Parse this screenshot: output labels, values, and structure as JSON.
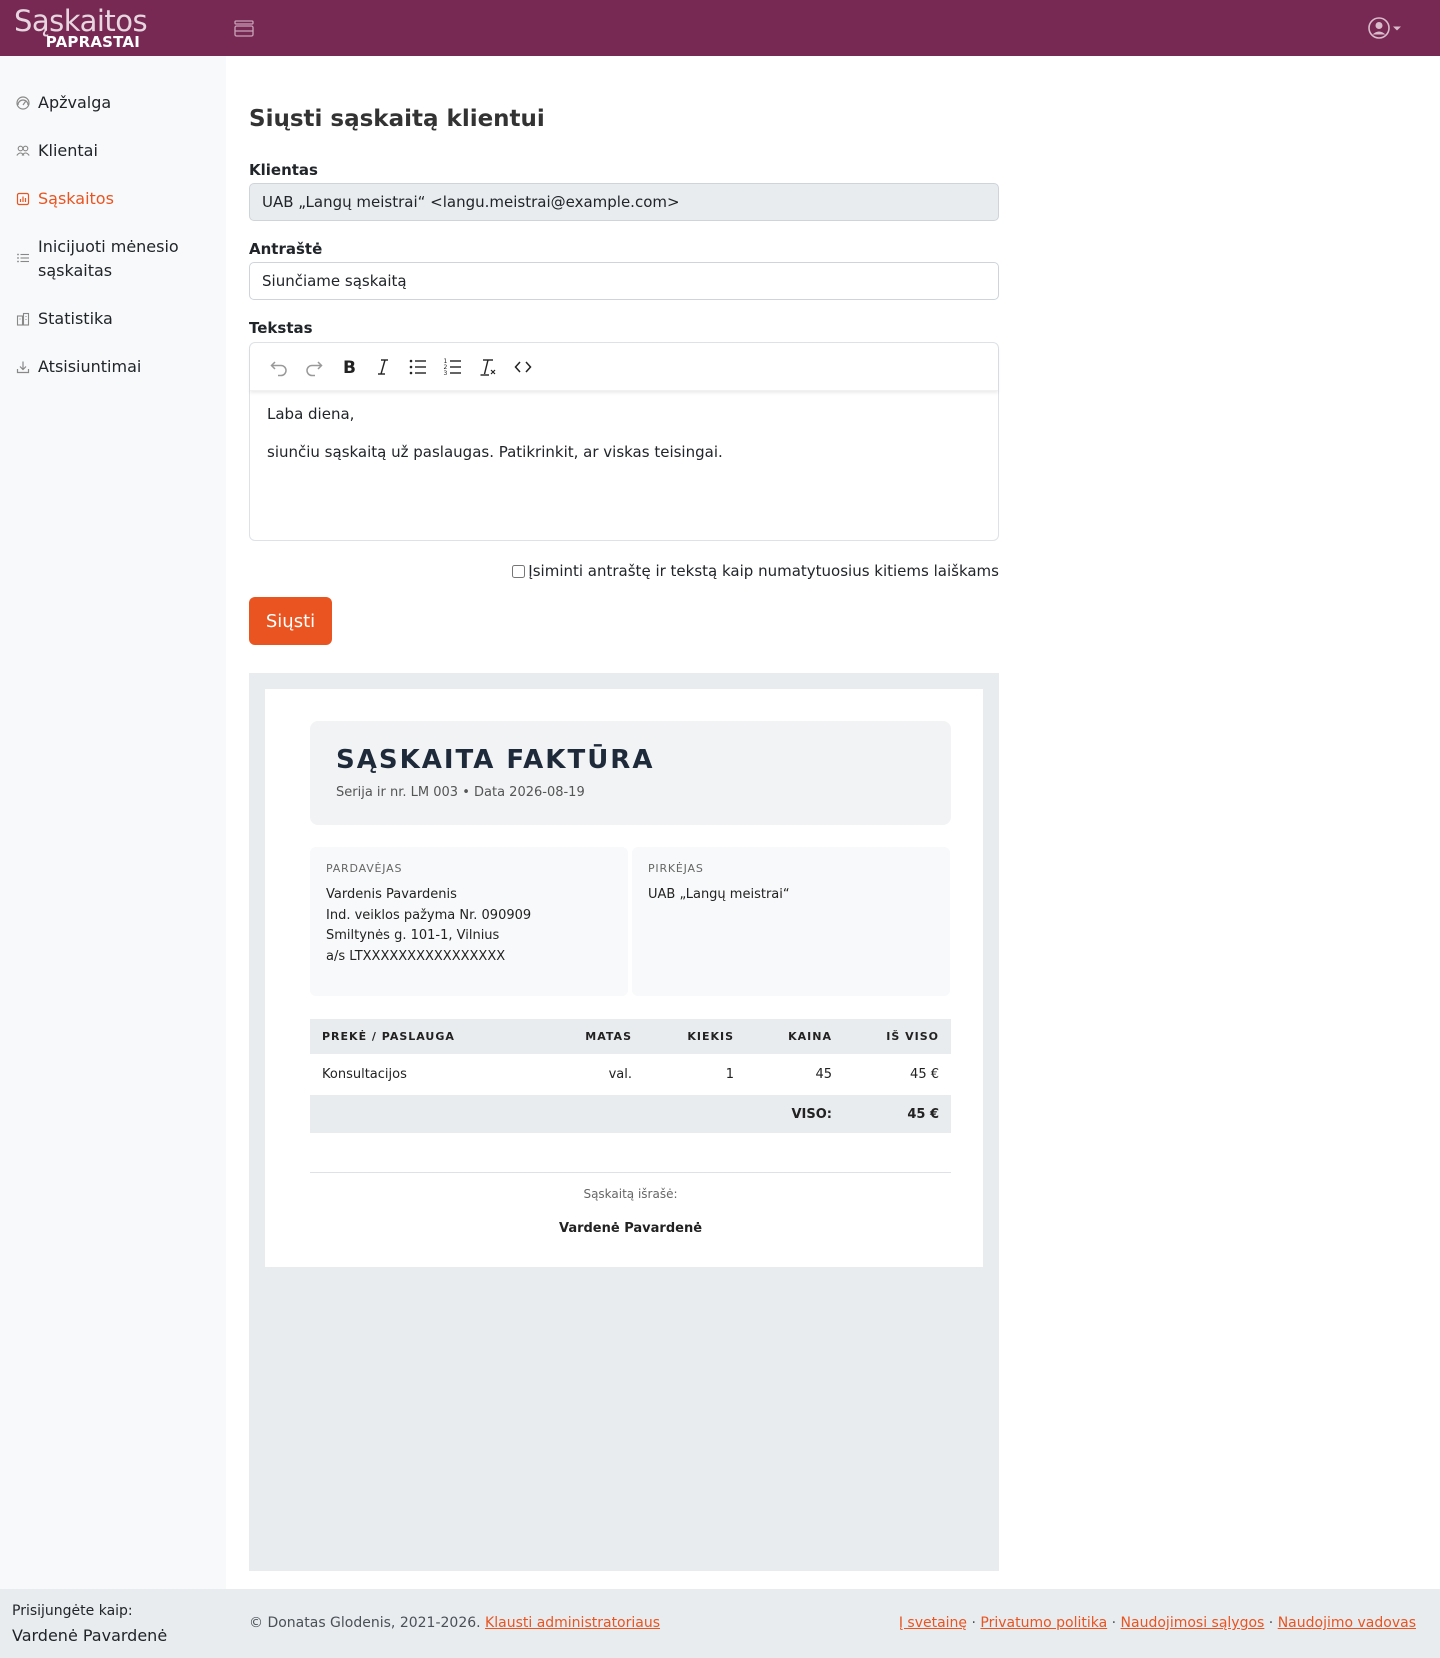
{
  "header": {
    "logo_top": "Sąskaitos",
    "logo_bottom": "PAPRASTAI",
    "menu_icon": "menu-toggle-icon",
    "user_icon": "user-circle-icon",
    "brand_color": "#772953",
    "accent_color": "#e95420"
  },
  "sidebar": {
    "items": [
      {
        "label": "Apžvalga",
        "icon": "dashboard-gauge-icon",
        "active": false
      },
      {
        "label": "Klientai",
        "icon": "people-icon",
        "active": false
      },
      {
        "label": "Sąskaitos",
        "icon": "invoice-icon",
        "active": true
      },
      {
        "label": "Inicijuoti mėnesio sąskaitas",
        "icon": "list-icon",
        "active": false
      },
      {
        "label": "Statistika",
        "icon": "buildings-icon",
        "active": false
      },
      {
        "label": "Atsisiuntimai",
        "icon": "download-icon",
        "active": false
      }
    ]
  },
  "form": {
    "title": "Siųsti sąskaitą klientui",
    "client_label": "Klientas",
    "client_value": "UAB „Langų meistrai“ <langu.meistrai@example.com>",
    "subject_label": "Antraštė",
    "subject_value": "Siunčiame sąskaitą",
    "text_label": "Tekstas",
    "toolbar": [
      "undo-icon",
      "redo-icon",
      "bold-icon",
      "italic-icon",
      "bullet-list-icon",
      "numbered-list-icon",
      "clear-format-icon",
      "code-icon"
    ],
    "body_lines": [
      "Laba diena,",
      "siunčiu sąskaitą už paslaugas. Patikrinkit, ar viskas teisingai."
    ],
    "remember_label": "Įsiminti antraštę ir tekstą kaip numatytuosius kitiems laiškams",
    "remember_checked": false,
    "send_label": "Siųsti"
  },
  "invoice": {
    "title": "SĄSKAITA FAKTŪRA",
    "meta": "Serija ir nr. LM 003  •  Data 2026-08-19",
    "seller_label": "PARDAVĖJAS",
    "seller_lines": [
      "Vardenis Pavardenis",
      "Ind. veiklos pažyma Nr. 090909",
      "Smiltynės g. 101-1, Vilnius",
      "a/s LTXXXXXXXXXXXXXXXX"
    ],
    "buyer_label": "PIRKĖJAS",
    "buyer_lines": [
      "UAB „Langų meistrai“"
    ],
    "columns": [
      "PREKĖ / PASLAUGA",
      "MATAS",
      "KIEKIS",
      "KAINA",
      "IŠ VISO"
    ],
    "rows": [
      [
        "Konsultacijos",
        "val.",
        "1",
        "45",
        "45 €"
      ]
    ],
    "total_label": "VISO:",
    "total_value": "45 €",
    "issued_label": "Sąskaitą išrašė:",
    "issued_name": "Vardenė Pavardenė"
  },
  "footer": {
    "logged_in_label": "Prisijungėte kaip:",
    "user_name": "Vardenė Pavardenė",
    "copyright": "© Donatas Glodenis, 2021-2026.",
    "ask_admin": "Klausti administratoriaus",
    "links": [
      "Į svetainę",
      "Privatumo politika",
      "Naudojimosi sąlygos",
      "Naudojimo vadovas"
    ],
    "separator": "·"
  }
}
